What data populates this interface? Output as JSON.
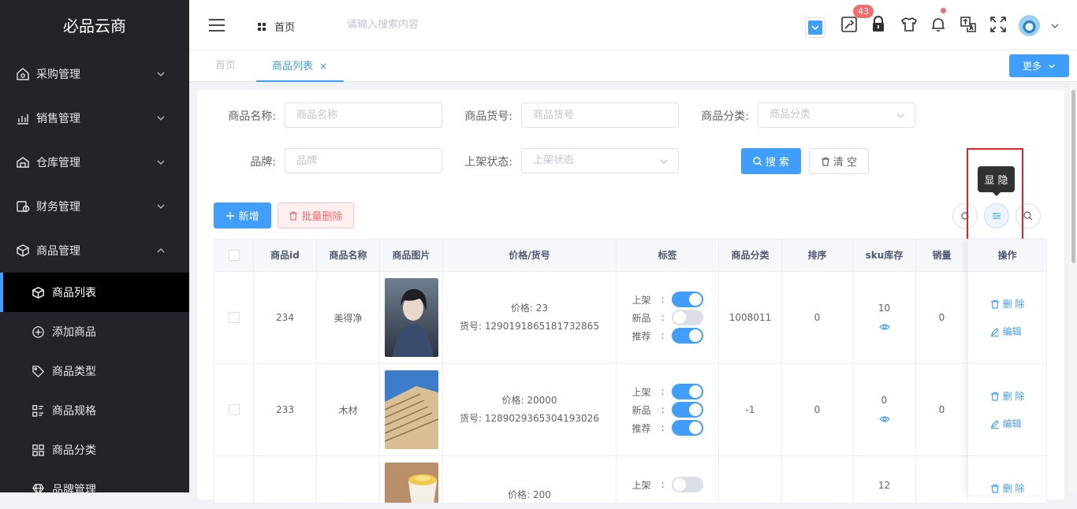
{
  "app": {
    "title": "必品云商"
  },
  "sidebar": {
    "items": [
      {
        "label": "采购管理",
        "icon": "purchase-icon"
      },
      {
        "label": "销售管理",
        "icon": "sales-chart-icon"
      },
      {
        "label": "仓库管理",
        "icon": "warehouse-icon"
      },
      {
        "label": "财务管理",
        "icon": "finance-icon"
      },
      {
        "label": "商品管理",
        "icon": "cube-icon",
        "expanded": true
      }
    ],
    "sub_items": [
      {
        "label": "商品列表",
        "icon": "cube-icon",
        "active": true
      },
      {
        "label": "添加商品",
        "icon": "plus-circle-icon"
      },
      {
        "label": "商品类型",
        "icon": "tag-icon"
      },
      {
        "label": "商品规格",
        "icon": "spec-list-icon"
      },
      {
        "label": "商品分类",
        "icon": "grid-icon"
      },
      {
        "label": "品牌管理",
        "icon": "diamond-icon"
      }
    ]
  },
  "header": {
    "breadcrumb": "首页",
    "search_placeholder": "请输入搜索内容",
    "badge_count": "43"
  },
  "tabs": {
    "home": "首页",
    "active": "商品列表",
    "close": "×",
    "more_label": "更多"
  },
  "filters": {
    "name_label": "商品名称:",
    "name_placeholder": "商品名称",
    "code_label": "商品货号:",
    "code_placeholder": "商品货号",
    "category_label": "商品分类:",
    "category_placeholder": "商品分类",
    "brand_label": "品牌:",
    "brand_placeholder": "品牌",
    "status_label": "上架状态:",
    "status_placeholder": "上架状态",
    "search_button": "搜 索",
    "clear_button": "清 空"
  },
  "toolbar": {
    "add_button": "新增",
    "batch_delete_button": "批量删除",
    "tooltip": "显 隐"
  },
  "table": {
    "headers": [
      "商品id",
      "商品名称",
      "商品图片",
      "价格/货号",
      "标签",
      "商品分类",
      "排序",
      "sku库存",
      "销量",
      "操作"
    ],
    "tag_names": [
      "上架",
      "新品",
      "推荐"
    ],
    "ops": {
      "delete": "删 除",
      "edit": "编辑"
    },
    "rows": [
      {
        "id": "234",
        "name": "美得净",
        "price": "价格: 23",
        "code": "货号: 1290191865181732865",
        "tags": [
          true,
          false,
          true
        ],
        "category": "1008011",
        "sort": "0",
        "sku": "10",
        "sales": "0",
        "image": "portrait"
      },
      {
        "id": "233",
        "name": "木材",
        "price": "价格: 20000",
        "code": "货号: 1289029365304193026",
        "tags": [
          true,
          true,
          true
        ],
        "category": "-1",
        "sort": "0",
        "sku": "0",
        "sales": "0",
        "image": "lumber"
      },
      {
        "id": "",
        "name": "",
        "price": "价格: 200",
        "code": "",
        "tags": [
          false
        ],
        "category": "",
        "sort": "",
        "sku": "12",
        "sales": "",
        "image": "cup"
      }
    ]
  }
}
